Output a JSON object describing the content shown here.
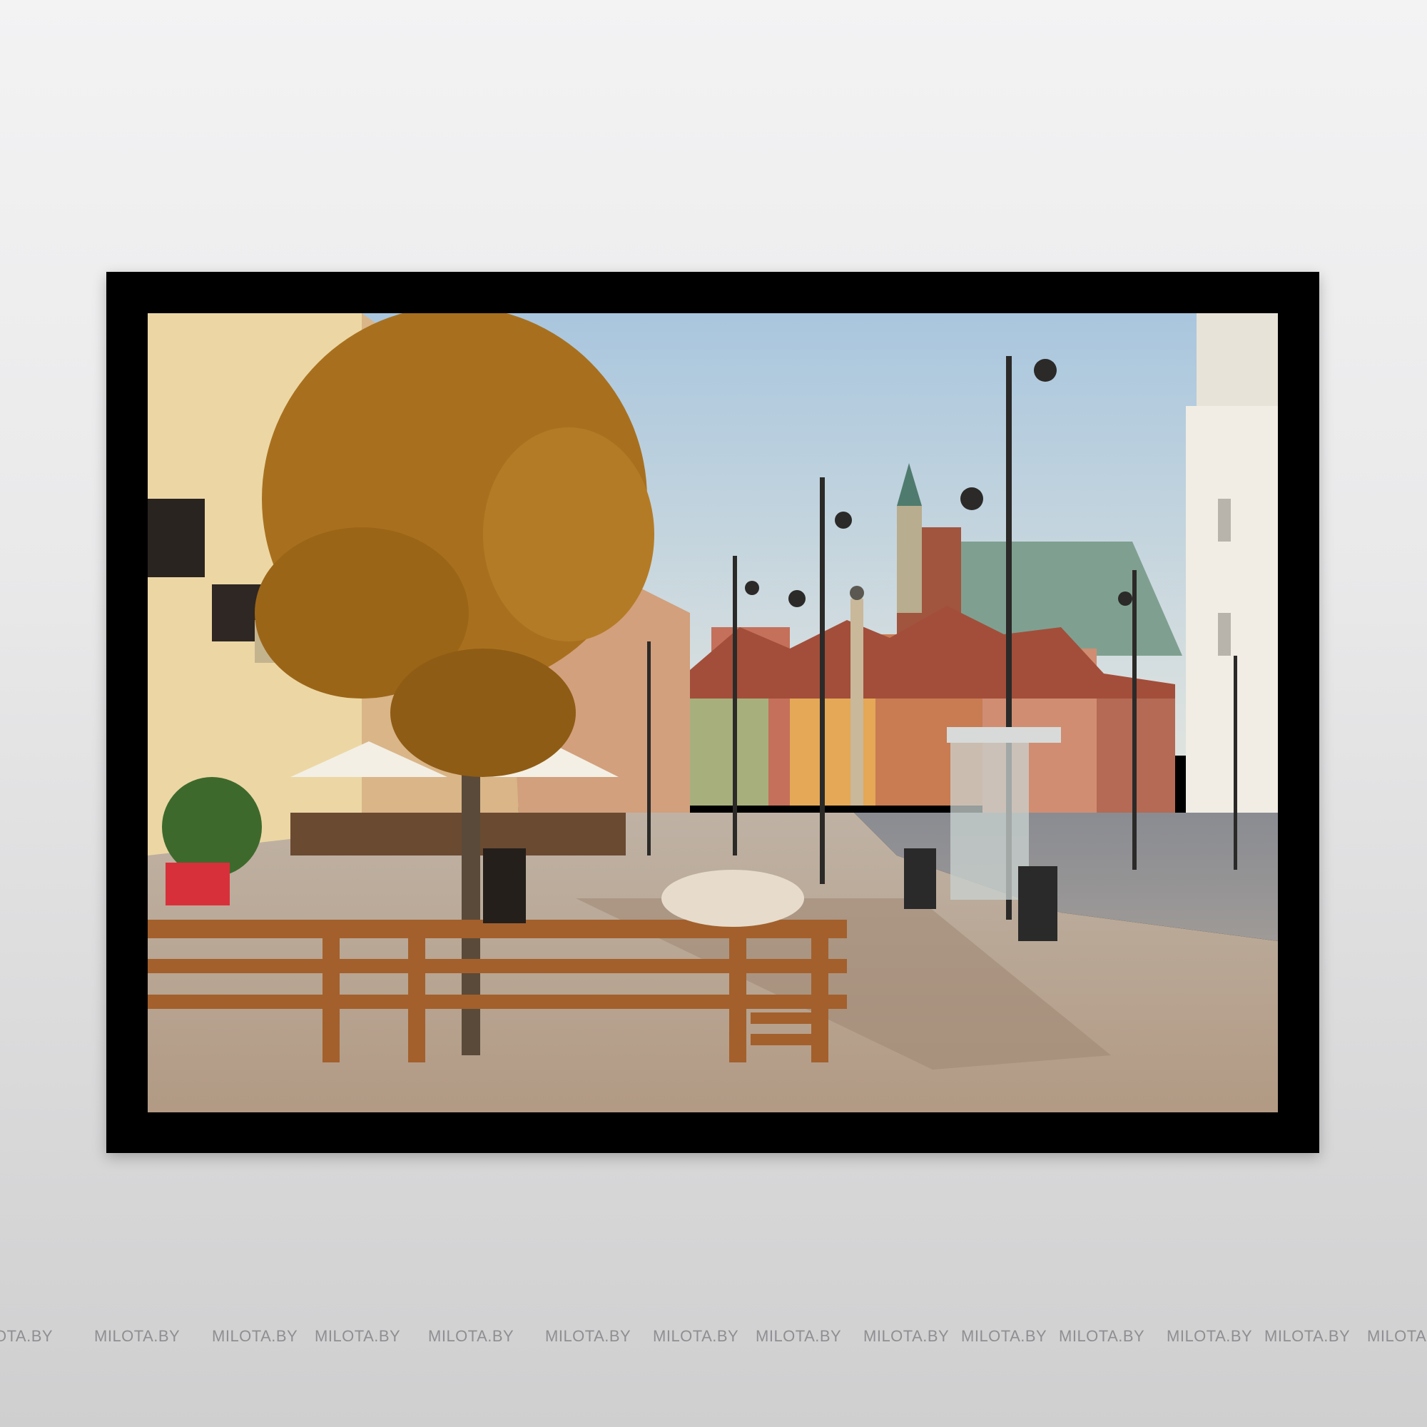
{
  "watermark": {
    "items": [
      "OTA.BY",
      "MILOTA.BY",
      "MILOTA.BY",
      "MILOTA.BY",
      "MILOTA.BY",
      "MILOTA.BY",
      "MILOTA.BY",
      "MILOTA.BY",
      "MILOTA.BY",
      "MILOTA.BY",
      "MILOTA.BY",
      "MILOTA.BY",
      "MILOTA.BY",
      "MILOTA"
    ]
  },
  "photo": {
    "scene": "street-square",
    "colors": {
      "sky": "#bcd4e6",
      "foliage": "#a8701e",
      "pavement": "#b9a692",
      "bench": "#a3602c",
      "frame": "#000000"
    }
  }
}
